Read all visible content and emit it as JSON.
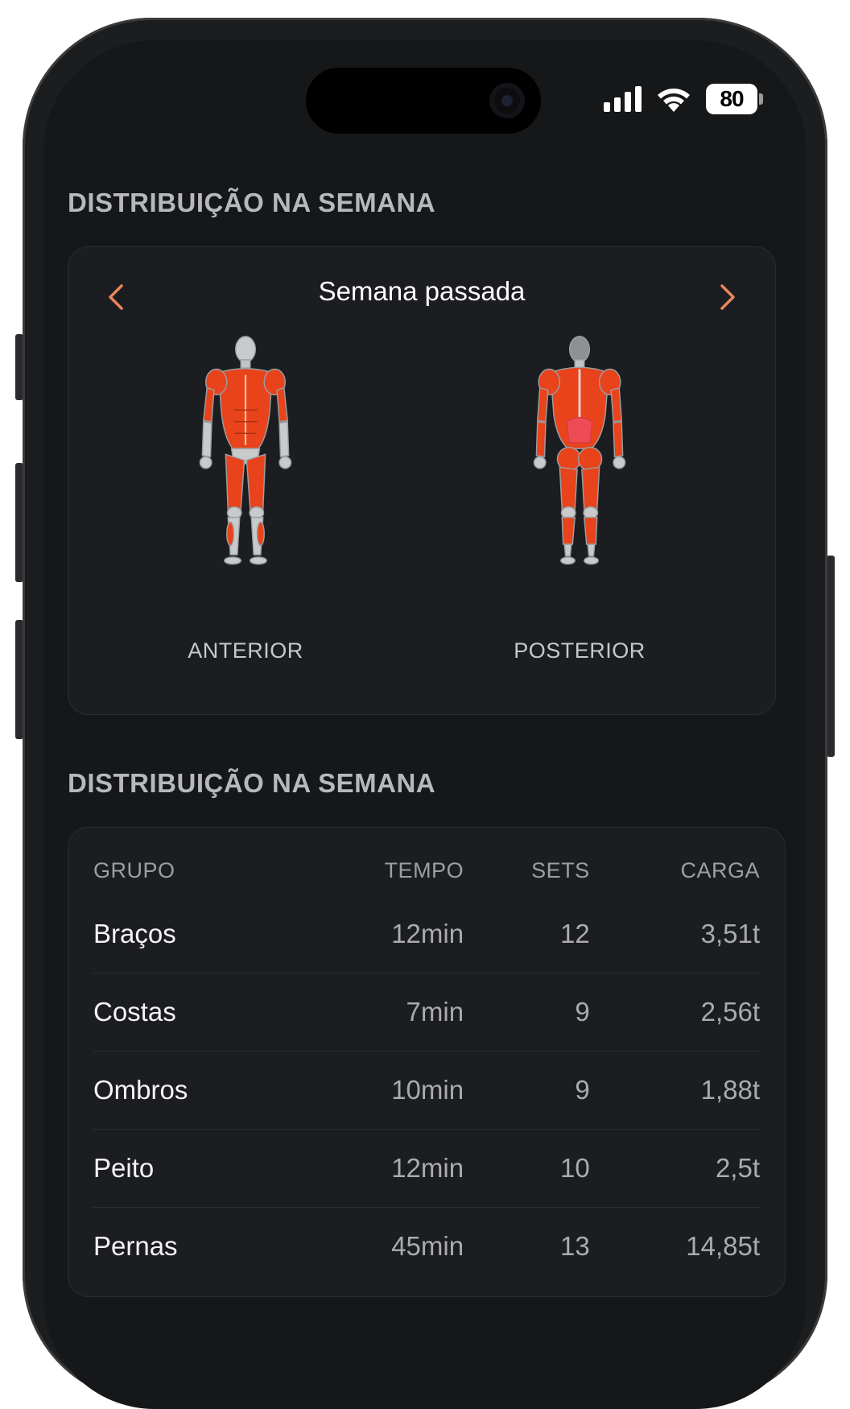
{
  "status_bar": {
    "battery_percent": "80",
    "icons": [
      "cellular-signal-icon",
      "wifi-icon",
      "battery-icon"
    ]
  },
  "sections": {
    "muscle_map_title": "DISTRIBUIÇÃO NA SEMANA",
    "table_title": "DISTRIBUIÇÃO NA SEMANA"
  },
  "week_selector": {
    "label": "Semana passada",
    "prev_icon": "chevron-left-icon",
    "next_icon": "chevron-right-icon",
    "accent_color": "#e8875a"
  },
  "body_views": {
    "anterior_label": "ANTERIOR",
    "posterior_label": "POSTERIOR",
    "muscle_color": "#e8431b",
    "highlight_color": "#ef4b55"
  },
  "table": {
    "headers": {
      "group": "GRUPO",
      "time": "TEMPO",
      "sets": "SETS",
      "load": "CARGA"
    },
    "rows": [
      {
        "group": "Braços",
        "time": "12min",
        "sets": "12",
        "load": "3,51t"
      },
      {
        "group": "Costas",
        "time": "7min",
        "sets": "9",
        "load": "2,56t"
      },
      {
        "group": "Ombros",
        "time": "10min",
        "sets": "9",
        "load": "1,88t"
      },
      {
        "group": "Peito",
        "time": "12min",
        "sets": "10",
        "load": "2,5t"
      },
      {
        "group": "Pernas",
        "time": "45min",
        "sets": "13",
        "load": "14,85t"
      }
    ]
  }
}
